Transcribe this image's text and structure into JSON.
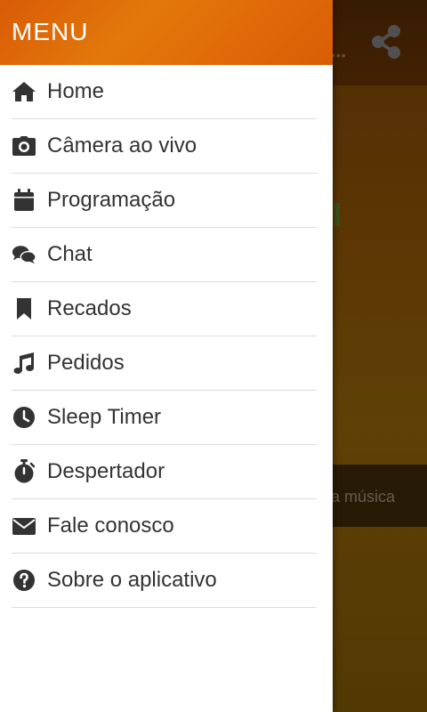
{
  "drawer": {
    "title": "MENU",
    "items": [
      {
        "label": "Home",
        "icon": "home-icon"
      },
      {
        "label": "Câmera ao vivo",
        "icon": "camera-icon"
      },
      {
        "label": "Programação",
        "icon": "calendar-icon"
      },
      {
        "label": "Chat",
        "icon": "chat-icon"
      },
      {
        "label": "Recados",
        "icon": "bookmark-icon"
      },
      {
        "label": "Pedidos",
        "icon": "music-note-icon"
      },
      {
        "label": "Sleep Timer",
        "icon": "clock-icon"
      },
      {
        "label": "Despertador",
        "icon": "stopwatch-icon"
      },
      {
        "label": "Fale conosco",
        "icon": "envelope-icon"
      },
      {
        "label": "Sobre o aplicativo",
        "icon": "question-circle-icon"
      }
    ]
  },
  "background_app": {
    "strip_text": "a música",
    "share_icon": "share-icon"
  },
  "colors": {
    "header_orange": "#e2780b",
    "text": "#333333",
    "divider": "#dcdcdc"
  }
}
